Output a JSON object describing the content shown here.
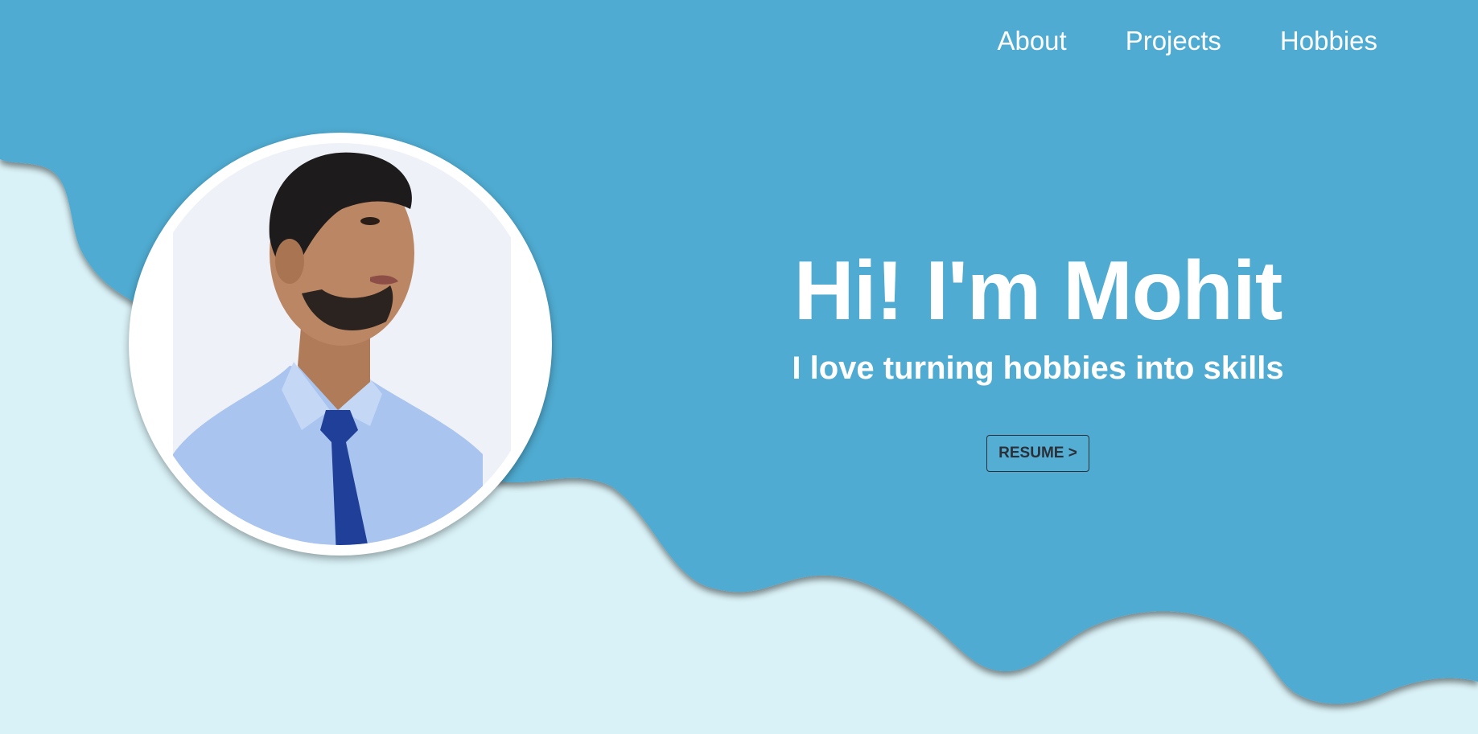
{
  "nav": {
    "items": [
      {
        "label": "About"
      },
      {
        "label": "Projects"
      },
      {
        "label": "Hobbies"
      }
    ]
  },
  "hero": {
    "title": "Hi! I'm Mohit",
    "subtitle": "I love turning hobbies into skills",
    "resume_label": "RESUME >"
  },
  "colors": {
    "primary_blue": "#50abd1",
    "light_bg": "#d9f2f7",
    "text_white": "#ffffff",
    "button_text": "#2b2f38"
  }
}
